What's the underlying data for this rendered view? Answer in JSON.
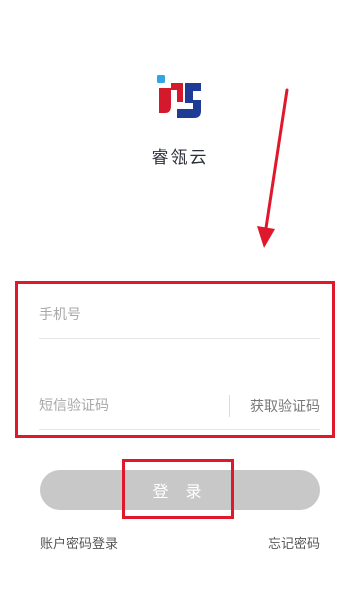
{
  "app": {
    "name": "睿瓴云",
    "brand_colors": {
      "red": "#d5192d",
      "blue": "#1e3b96",
      "light_blue": "#2fa5e6"
    }
  },
  "form": {
    "phone_placeholder": "手机号",
    "code_placeholder": "短信验证码",
    "get_code_label": "获取验证码"
  },
  "login_button_label": "登 录",
  "links": {
    "account_login": "账户密码登录",
    "forgot_password": "忘记密码"
  },
  "annotations": {
    "color": "#e0182c",
    "form_highlight": "rectangle",
    "login_highlight": "rectangle",
    "arrow": "pointing-down-to-form"
  }
}
